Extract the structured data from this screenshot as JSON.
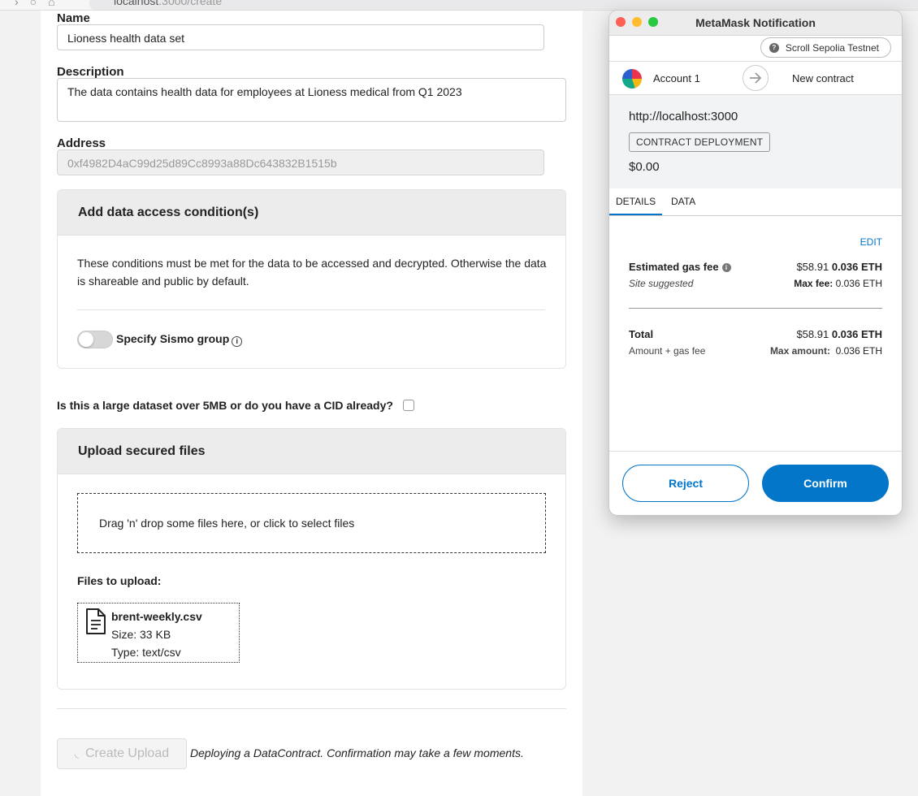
{
  "browser": {
    "url_host": "localhost",
    "url_rest": ":3000/create"
  },
  "form": {
    "name_label": "Name",
    "name_value": "Lioness health data set",
    "description_label": "Description",
    "description_value": "The data contains health data for employees at Lioness medical from Q1 2023",
    "address_label": "Address",
    "address_value": "0xf4982D4aC99d25d89Cc8993a88Dc643832B1515b",
    "access_card": {
      "title": "Add data access condition(s)",
      "text": "These conditions must be met for the data to be accessed and decrypted. Otherwise the data is shareable and public by default.",
      "toggle_label": "Specify Sismo group",
      "toggle_on": false
    },
    "large_dataset_question": "Is this a large dataset over 5MB or do you have a CID already?",
    "upload_card": {
      "title": "Upload secured files",
      "dropzone_text": "Drag 'n' drop some files here, or click to select files",
      "files_label": "Files to upload:",
      "files": [
        {
          "name": "brent-weekly.csv",
          "size": "Size: 33 KB",
          "type": "Type: text/csv"
        }
      ]
    },
    "create_button": "Create Upload",
    "deploy_message": "Deploying a DataContract. Confirmation may take a few moments."
  },
  "metamask": {
    "window_title": "MetaMask Notification",
    "network": "Scroll Sepolia Testnet",
    "account": "Account 1",
    "target": "New contract",
    "origin": "http://localhost:3000",
    "badge": "CONTRACT DEPLOYMENT",
    "amount": "$0.00",
    "tabs": [
      "DETAILS",
      "DATA"
    ],
    "active_tab": "DETAILS",
    "edit": "EDIT",
    "gas": {
      "label": "Estimated gas fee",
      "sublabel": "Site suggested",
      "fiat": "$58.91",
      "eth": "0.036 ETH",
      "max_label": "Max fee:",
      "max_value": "0.036 ETH"
    },
    "total": {
      "label": "Total",
      "sublabel": "Amount + gas fee",
      "fiat": "$58.91",
      "eth": "0.036 ETH",
      "max_label": "Max amount:",
      "max_value": "0.036 ETH"
    },
    "reject": "Reject",
    "confirm": "Confirm"
  },
  "colors": {
    "accent": "#0376c9",
    "traffic_red": "#fe5f57",
    "traffic_yellow": "#febc2e",
    "traffic_green": "#28c840"
  }
}
